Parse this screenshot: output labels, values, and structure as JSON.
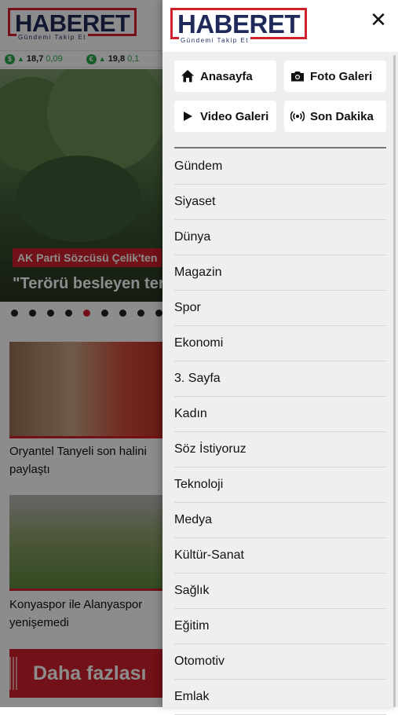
{
  "brand": {
    "name": "HABERET",
    "tagline": "Gündemi Takip Et",
    "red": "#d0202b",
    "navy": "#1f2a5a"
  },
  "ticker": [
    {
      "icon": "dollar-icon",
      "symbol": "$",
      "value": "18,7",
      "change": "0,09"
    },
    {
      "icon": "euro-icon",
      "symbol": "€",
      "value": "19,8",
      "change": "0,1"
    }
  ],
  "hero": {
    "tag": "AK Parti Sözcüsü Çelik'ten",
    "title": "\"Terörü besleyen ter",
    "slide_count": 9,
    "active_slide": 4
  },
  "cards": [
    {
      "title": "Oryantel Tanyeli son halini paylaştı"
    },
    {
      "title": "Konyaspor ile Alanyaspor yenişemedi"
    }
  ],
  "more_button": "Daha fazlası",
  "drawer": {
    "close_symbol": "✕",
    "quick_links": [
      {
        "icon": "home-icon",
        "label": "Anasayfa"
      },
      {
        "icon": "camera-icon",
        "label": "Foto Galeri"
      },
      {
        "icon": "play-icon",
        "label": "Video Galeri"
      },
      {
        "icon": "broadcast-icon",
        "label": "Son Dakika"
      }
    ],
    "menu": [
      "Gündem",
      "Siyaset",
      "Dünya",
      "Magazin",
      "Spor",
      "Ekonomi",
      "3. Sayfa",
      "Kadın",
      "Söz İstiyoruz",
      "Teknoloji",
      "Medya",
      "Kültür-Sanat",
      "Sağlık",
      "Eğitim",
      "Otomotiv",
      "Emlak"
    ]
  }
}
